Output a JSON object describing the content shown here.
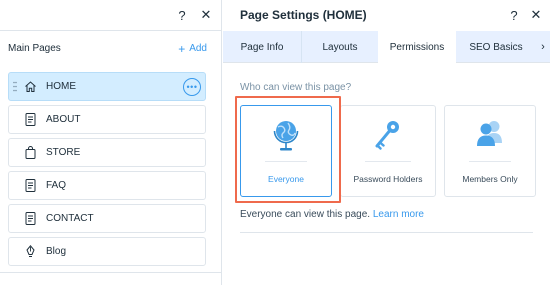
{
  "pages_panel": {
    "help_label": "?",
    "close_label": "✕",
    "title": "Main Pages",
    "add_label": "Add",
    "add_symbol": "+",
    "more_label": "•••",
    "items": [
      {
        "label": "HOME",
        "icon": "home-icon",
        "selected": true
      },
      {
        "label": "ABOUT",
        "icon": "page-icon"
      },
      {
        "label": "STORE",
        "icon": "store-bag-icon"
      },
      {
        "label": "FAQ",
        "icon": "page-icon"
      },
      {
        "label": "CONTACT",
        "icon": "page-icon"
      },
      {
        "label": "Blog",
        "icon": "blog-pen-icon"
      }
    ]
  },
  "page_settings": {
    "title": "Page Settings (HOME)",
    "help_label": "?",
    "close_label": "✕",
    "tabs": [
      {
        "label": "Page Info"
      },
      {
        "label": "Layouts"
      },
      {
        "label": "Permissions",
        "active": true
      },
      {
        "label": "SEO Basics"
      }
    ],
    "tabs_more_label": "›",
    "question": "Who can view this page?",
    "options": [
      {
        "label": "Everyone",
        "icon": "globe-icon",
        "selected": true
      },
      {
        "label": "Password Holders",
        "icon": "key-icon"
      },
      {
        "label": "Members Only",
        "icon": "members-icon"
      }
    ],
    "description": "Everyone can view this page.",
    "learn_more": "Learn more"
  },
  "colors": {
    "accent": "#3899ec",
    "selected_bg": "#d3edff",
    "tab_bar_bg": "#e7f0ff",
    "highlight": "#ef6a4c"
  }
}
